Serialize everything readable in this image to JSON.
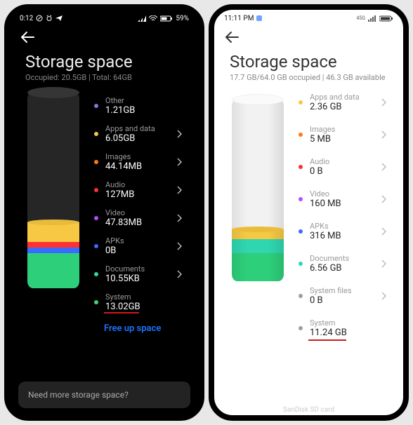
{
  "colors": {
    "other": "#7e7ad6",
    "apps": "#f7c843",
    "images": "#ff7a1a",
    "audio": "#ff3030",
    "video": "#b54bff",
    "apks": "#3a6bff",
    "documents": "#2fd6b0",
    "system": "#9e9e9e",
    "systemGreen": "#2dcf7a",
    "systemDark": "#46d17c"
  },
  "left": {
    "status": {
      "time": "0:12",
      "battery": "59%"
    },
    "title": "Storage space",
    "subtitle": "Occupied: 20.5GB | Total: 64GB",
    "items": [
      {
        "name": "Other",
        "value": "1.21GB",
        "color": "other",
        "chev": false
      },
      {
        "name": "Apps and data",
        "value": "6.05GB",
        "color": "apps",
        "chev": true
      },
      {
        "name": "Images",
        "value": "44.14MB",
        "color": "images",
        "chev": true
      },
      {
        "name": "Audio",
        "value": "127MB",
        "color": "audio",
        "chev": true
      },
      {
        "name": "Video",
        "value": "47.83MB",
        "color": "video",
        "chev": true
      },
      {
        "name": "APKs",
        "value": "0B",
        "color": "apks",
        "chev": true
      },
      {
        "name": "Documents",
        "value": "10.55KB",
        "color": "documents",
        "chev": true
      },
      {
        "name": "System",
        "value": "13.02GB",
        "color": "systemDark",
        "chev": false,
        "underline": true
      }
    ],
    "freeup": "Free up space",
    "footer": "Need more storage space?"
  },
  "right": {
    "status": {
      "time": "11:11 PM"
    },
    "title": "Storage space",
    "subtitle": "17.7 GB/64.0 GB occupied | 46.3 GB available",
    "items": [
      {
        "name": "Apps and data",
        "value": "2.36 GB",
        "color": "apps",
        "chev": true
      },
      {
        "name": "Images",
        "value": "5 MB",
        "color": "images",
        "chev": true
      },
      {
        "name": "Audio",
        "value": "0 B",
        "color": "audio",
        "chev": true
      },
      {
        "name": "Video",
        "value": "160 MB",
        "color": "video",
        "chev": true
      },
      {
        "name": "APKs",
        "value": "316 MB",
        "color": "apks",
        "chev": true
      },
      {
        "name": "Documents",
        "value": "6.56 GB",
        "color": "documents",
        "chev": true
      },
      {
        "name": "System files",
        "value": "0 B",
        "color": "system",
        "chev": true
      },
      {
        "name": "System",
        "value": "11.24 GB",
        "color": "system",
        "chev": false,
        "underline": true
      }
    ],
    "sd": "SanDisk SD card"
  }
}
